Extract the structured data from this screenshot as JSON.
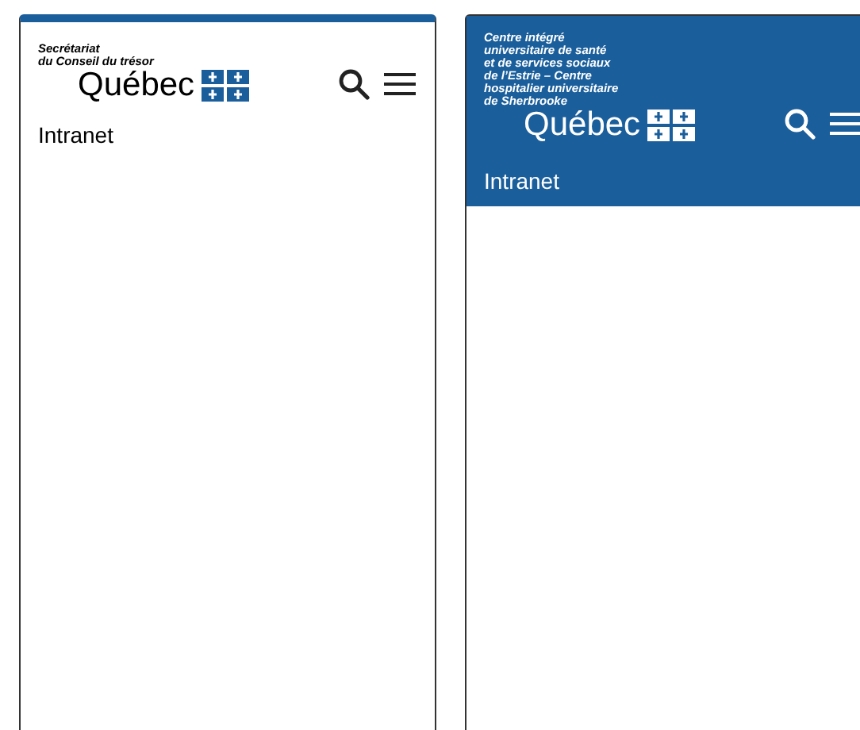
{
  "frames": [
    {
      "kind": "light",
      "org_lines": [
        "Secrétariat",
        "du Conseil du trésor"
      ],
      "wordmark": "Québec",
      "section": "Intranet"
    },
    {
      "kind": "dark",
      "org_lines": [
        "Centre intégré",
        "universitaire de santé",
        "et de services sociaux",
        "de l’Estrie – Centre",
        "hospitalier universitaire",
        "de Sherbrooke"
      ],
      "wordmark": "Québec",
      "section": "Intranet"
    }
  ]
}
